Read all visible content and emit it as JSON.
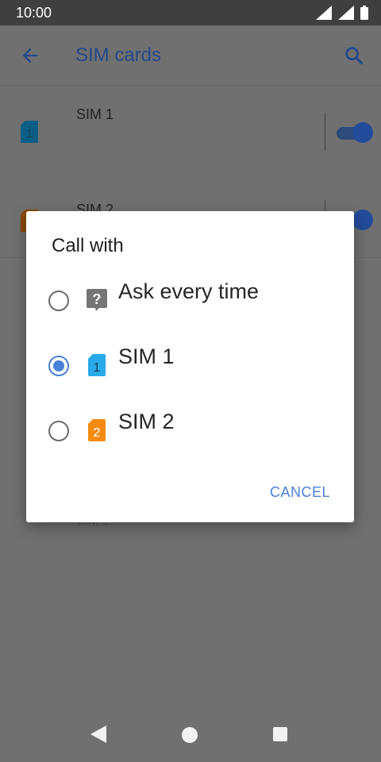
{
  "status_bar": {
    "time": "10:00"
  },
  "app_bar": {
    "title": "SIM cards"
  },
  "sim_list": [
    {
      "name": "SIM 1",
      "badge": "1",
      "color": "#0a5e86",
      "enabled": true
    },
    {
      "name": "SIM 2",
      "badge": "2",
      "color": "#8a4a00",
      "enabled": true
    }
  ],
  "behind_dialog": {
    "partial_label": "SIM 1"
  },
  "dialog": {
    "title": "Call with",
    "options": [
      {
        "label": "Ask every time",
        "icon": "question-icon",
        "selected": false
      },
      {
        "label": "SIM 1",
        "icon": "sim-1-icon",
        "badge": "1",
        "color": "#29a9e8",
        "selected": true
      },
      {
        "label": "SIM 2",
        "icon": "sim-2-icon",
        "badge": "2",
        "color": "#f48c12",
        "selected": false
      }
    ],
    "cancel_label": "CANCEL"
  },
  "colors": {
    "accent": "#4a80d9",
    "scrim": "#6f6f6f"
  }
}
